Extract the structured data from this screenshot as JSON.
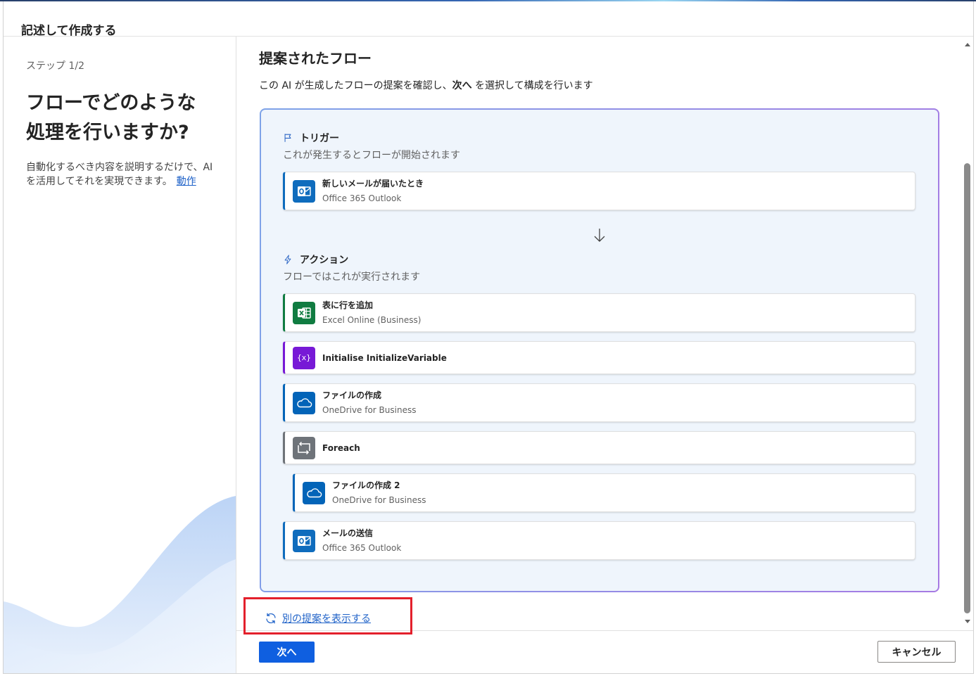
{
  "dialog": {
    "title": "記述して作成する"
  },
  "sidebar": {
    "step": "ステップ 1/2",
    "heading_lines": [
      "フローでどのような",
      "処理を行いますか?"
    ],
    "description_lines": [
      "自動化するべき内容を説明するだけで、AI",
      "を活用してそれを実現できます。"
    ],
    "link": "動作"
  },
  "main": {
    "title": "提案されたフロー",
    "intro": {
      "before": "この AI が生成したフローの提案を確認し、",
      "emphasis": "次へ",
      "after": " を選択して構成を行います"
    },
    "trigger": {
      "icon": "flag-icon",
      "label": "トリガー",
      "description": "これが発生するとフローが開始されます",
      "step": {
        "title": "新しいメールが届いたとき",
        "connector": "Office 365 Outlook",
        "icon": "outlook-icon",
        "color": "#0f6cbd"
      }
    },
    "connector_icon": "arrow-down-icon",
    "actions": {
      "icon": "lightning-icon",
      "label": "アクション",
      "description": "フローではこれが実行されます",
      "steps": [
        {
          "title": "表に行を追加",
          "connector": "Excel Online (Business)",
          "icon": "excel-icon",
          "color": "#107c41",
          "depth": 0
        },
        {
          "title": "Initialise InitializeVariable",
          "icon": "variable-icon",
          "glyph": "{x}",
          "color": "#7719d6",
          "depth": 0
        },
        {
          "title": "ファイルの作成",
          "connector": "OneDrive for Business",
          "icon": "onedrive-icon",
          "color": "#0364b8",
          "depth": 0
        },
        {
          "title": "Foreach",
          "icon": "loop-icon",
          "color": "#6e7379",
          "depth": 0
        },
        {
          "title": "ファイルの作成 2",
          "connector": "OneDrive for Business",
          "icon": "onedrive-icon",
          "color": "#0364b8",
          "depth": 1
        },
        {
          "title": "メールの送信",
          "connector": "Office 365 Outlook",
          "icon": "outlook-icon",
          "color": "#0f6cbd",
          "depth": 0
        }
      ]
    },
    "alternative": {
      "icon": "refresh-icon",
      "label": "別の提案を表示する"
    }
  },
  "footer": {
    "next": "次へ",
    "cancel": "キャンセル"
  },
  "colors": {
    "link": "#1f62c8",
    "primary_button": "#0f5fe0",
    "highlight": "#e3202c",
    "flow_background": "#eff5fc",
    "flow_border_start": "#7ea3e8",
    "flow_border_end": "#a67ae3",
    "section_icon": "#2b65c4"
  }
}
